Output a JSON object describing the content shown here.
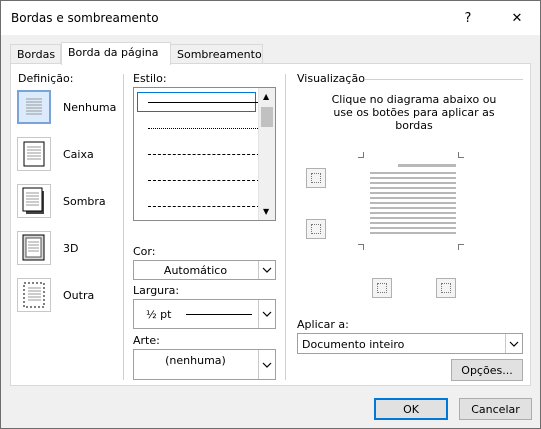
{
  "window": {
    "title": "Bordas e sombreamento",
    "help_label": "?",
    "close_label": "✕"
  },
  "tabs": [
    {
      "label": "Bordas",
      "active": false
    },
    {
      "label": "Borda da página",
      "active": true
    },
    {
      "label": "Sombreamento",
      "active": false
    }
  ],
  "settings": {
    "heading": "Definição:",
    "items": [
      {
        "label": "Nenhuma",
        "selected": true
      },
      {
        "label": "Caixa",
        "selected": false
      },
      {
        "label": "Sombra",
        "selected": false
      },
      {
        "label": "3D",
        "selected": false
      },
      {
        "label": "Outra",
        "selected": false
      }
    ]
  },
  "style": {
    "heading": "Estilo:",
    "options": [
      "solid",
      "dotted",
      "dashed-small",
      "dashed",
      "dash-dot"
    ]
  },
  "color": {
    "label": "Cor:",
    "value": "Automático"
  },
  "width": {
    "label": "Largura:",
    "value": "½ pt"
  },
  "art": {
    "label": "Arte:",
    "value": "(nenhuma)"
  },
  "preview": {
    "heading": "Visualização",
    "instructions": "Clique no diagrama abaixo ou use os botões para aplicar as bordas"
  },
  "apply_to": {
    "label": "Aplicar a:",
    "value": "Documento inteiro"
  },
  "buttons": {
    "options": "Opções...",
    "ok": "OK",
    "cancel": "Cancelar"
  },
  "colors": {
    "accent": "#0078d7",
    "selection": "#dcebfb"
  }
}
